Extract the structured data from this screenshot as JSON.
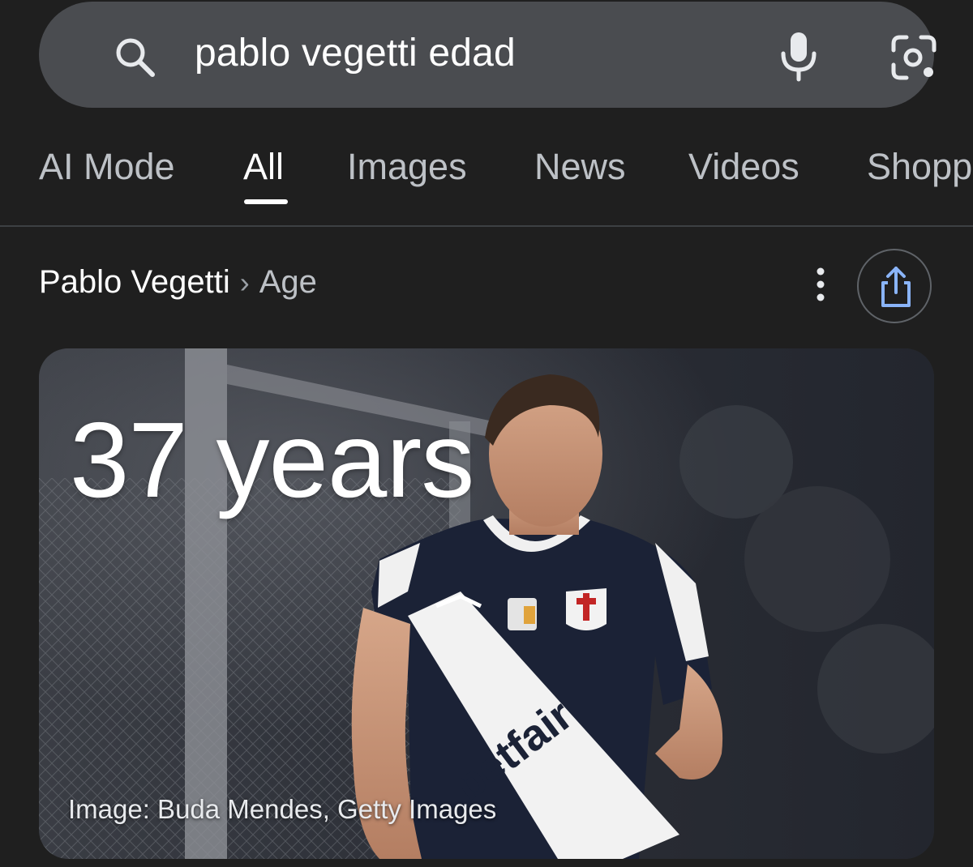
{
  "search": {
    "query": "pablo vegetti edad",
    "icons": {
      "search": "search-icon",
      "voice": "mic-icon",
      "lens": "lens-icon"
    }
  },
  "tabs": [
    {
      "label": "AI Mode",
      "active": false
    },
    {
      "label": "All",
      "active": true
    },
    {
      "label": "Images",
      "active": false
    },
    {
      "label": "News",
      "active": false
    },
    {
      "label": "Videos",
      "active": false
    },
    {
      "label": "Shopp",
      "active": false
    }
  ],
  "breadcrumb": {
    "entity": "Pablo Vegetti",
    "separator": "›",
    "attribute": "Age"
  },
  "answer": {
    "value": "37 years",
    "image_credit": "Image: Buda Mendes, Getty Images",
    "jersey_sponsor": "betfair"
  },
  "colors": {
    "background": "#1f1f1f",
    "search_bar": "#4a4c50",
    "active_tab": "#ffffff",
    "inactive_tab": "#bdc1c6",
    "share_icon": "#8ab4f8",
    "divider": "#3c4043"
  }
}
